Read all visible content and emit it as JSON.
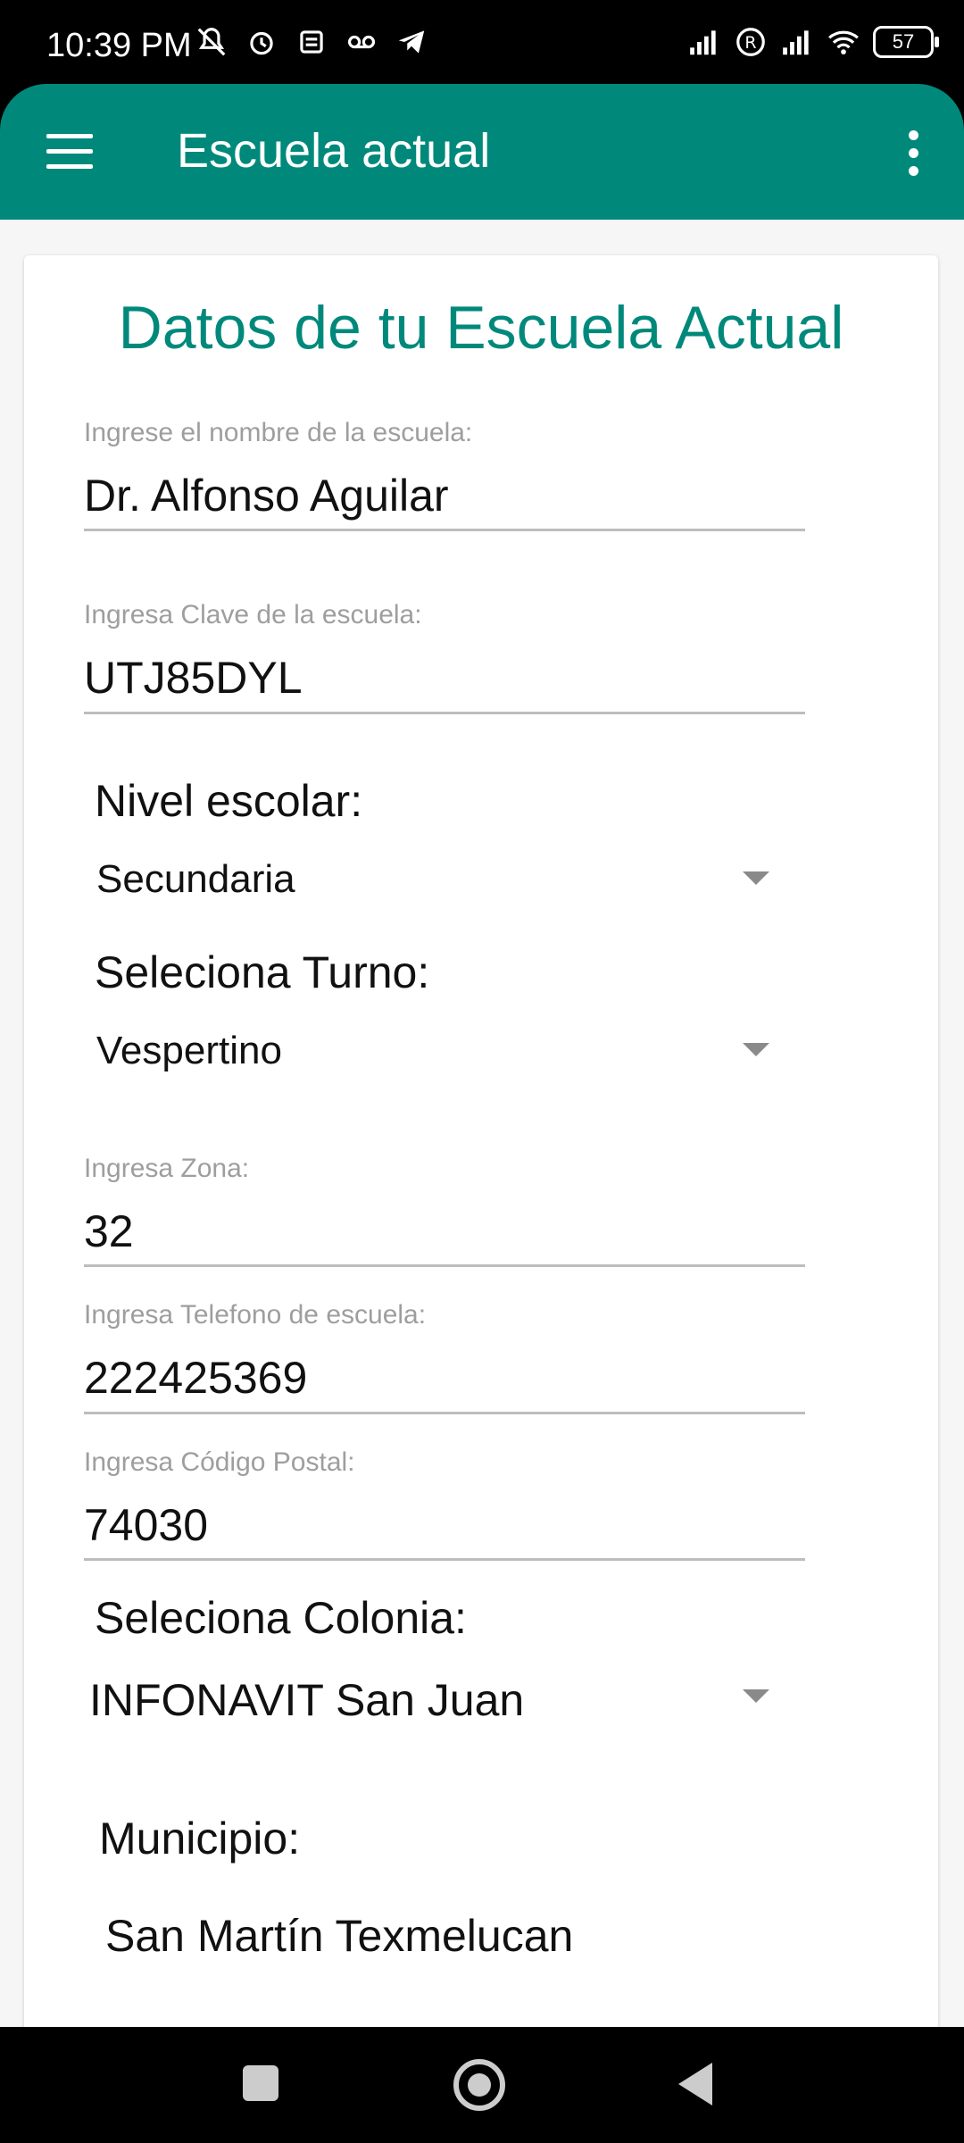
{
  "status_bar": {
    "time": "10:39 PM",
    "battery": "57",
    "icons": [
      "mute-icon",
      "alarm-icon",
      "sim-icon",
      "voicemail-icon",
      "telegram-icon",
      "signal-icon",
      "roaming-icon",
      "signal-icon",
      "wifi-icon",
      "battery-icon"
    ]
  },
  "app_bar": {
    "title": "Escuela actual",
    "accent": "#00897b"
  },
  "card": {
    "title": "Datos de tu Escuela Actual",
    "school_name": {
      "label": "Ingrese el nombre de la escuela:",
      "value": "Dr. Alfonso Aguilar"
    },
    "school_key": {
      "label": "Ingresa Clave de la escuela:",
      "value": "UTJ85DYL"
    },
    "level": {
      "label": "Nivel escolar:",
      "value": "Secundaria"
    },
    "shift": {
      "label": "Seleciona Turno:",
      "value": "Vespertino"
    },
    "zone": {
      "label": "Ingresa Zona:",
      "value": "32"
    },
    "phone": {
      "label": "Ingresa Telefono de escuela:",
      "value": "222425369"
    },
    "postal_code": {
      "label": "Ingresa Código Postal:",
      "value": "74030"
    },
    "colony": {
      "label": "Seleciona Colonia:",
      "value": "INFONAVIT San Juan"
    },
    "municipality": {
      "label": "Municipio:",
      "value": "San Martín Texmelucan"
    }
  }
}
